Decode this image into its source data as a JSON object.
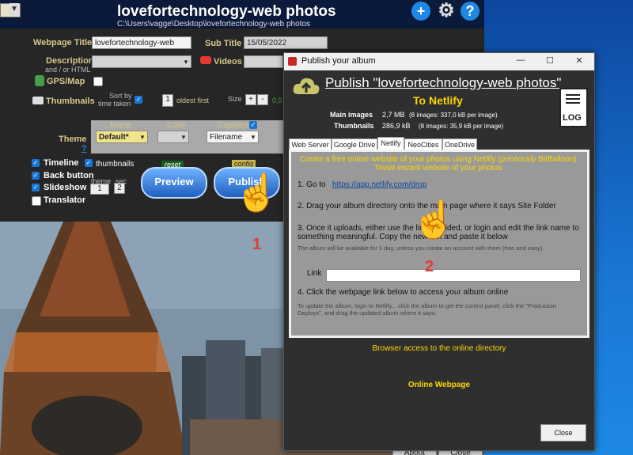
{
  "app": {
    "title": "lovefortechnology-web photos",
    "path": "C:\\Users\\vagge\\Desktop\\lovefortechnology-web photos",
    "webpage_title_label": "Webpage Title",
    "webpage_title_value": "lovefortechnology-web photos",
    "subtitle_label": "Sub Title",
    "subtitle_value": "15/05/2022",
    "description_label": "Description",
    "description_sub": "and / or HTML",
    "videos_label": "Videos",
    "gpsmap_label": "GPS/Map",
    "thumbnails_label": "Thumbnails",
    "sort_label": "Sort by",
    "sort_sub": "time taken",
    "sort_value": "1",
    "oldest_label": "oldest first",
    "size_label": "Size",
    "size_value": "0,9",
    "theme_label": "Theme",
    "theme_help": "?",
    "name_col": "Name",
    "color_col": "Color",
    "captions_col": "Captions",
    "theme_value": "Default*",
    "captions_value": "Filename",
    "timeline_label": "Timeline",
    "thumbnails_check_label": "thumbnails",
    "backbutton_label": "Back button",
    "slideshow_label": "Slideshow",
    "translator_label": "Translator",
    "theme_small": "theme",
    "sec_small": "sec",
    "theme_num": "1",
    "sec_num": "2",
    "reset_tag": "reset",
    "config_tag": "config",
    "preview_button": "Preview",
    "publish_button": "Publish",
    "about_button": "About",
    "close_button": "Close"
  },
  "dialog": {
    "title": "Publish your album",
    "heading": "Publish \"lovefortechnology-web photos\"",
    "subheading": "To Netlify",
    "main_images_label": "Main images",
    "main_images_size": "2,7 MB",
    "main_images_detail": "(8 images: 337,0 kB per image)",
    "thumbnails_label": "Thumbnails",
    "thumbnails_size": "286,9 kB",
    "thumbnails_detail": "(8 images: 35,9 kB per image)",
    "log_label": "LOG",
    "tabs": [
      "Web Server",
      "Google Drive",
      "Netlify",
      "NeoCities",
      "OneDrive"
    ],
    "active_tab": "Netlify",
    "intro": "Create a free online website of your photos using Netlify (previously BitBalloon). Trivial instant website of your photos.",
    "step1": "1. Go to",
    "step1_link": "https://app.netlify.com/drop",
    "step2": "2. Drag your album directory onto the main page where it says Site Folder",
    "step3": "3. Once it uploads, either use the link provided, or login and edit the link name to something meaningful. Copy the new link and paste it below",
    "step3_note": "The album will be available for 1 day, unless you create an account with them (free and easy).",
    "link_label": "Link",
    "step4": "4. Click the webpage link below to access your album online",
    "step4_note": "To update the album, login to Netlify... click the album to get the control panel, click the \"Production Deploys\", and drag the updated album where it says.",
    "browser_access": "Browser access to the online directory",
    "online_webpage": "Online Webpage",
    "close_button": "Close"
  },
  "annotations": {
    "marker1": "1",
    "marker2": "2"
  },
  "colors": {
    "accent_yellow": "#ffd600",
    "label_gold": "#d7c78a",
    "app_bg": "#262626",
    "desktop_blue": "#1565c0",
    "marker_red": "#e53935"
  }
}
